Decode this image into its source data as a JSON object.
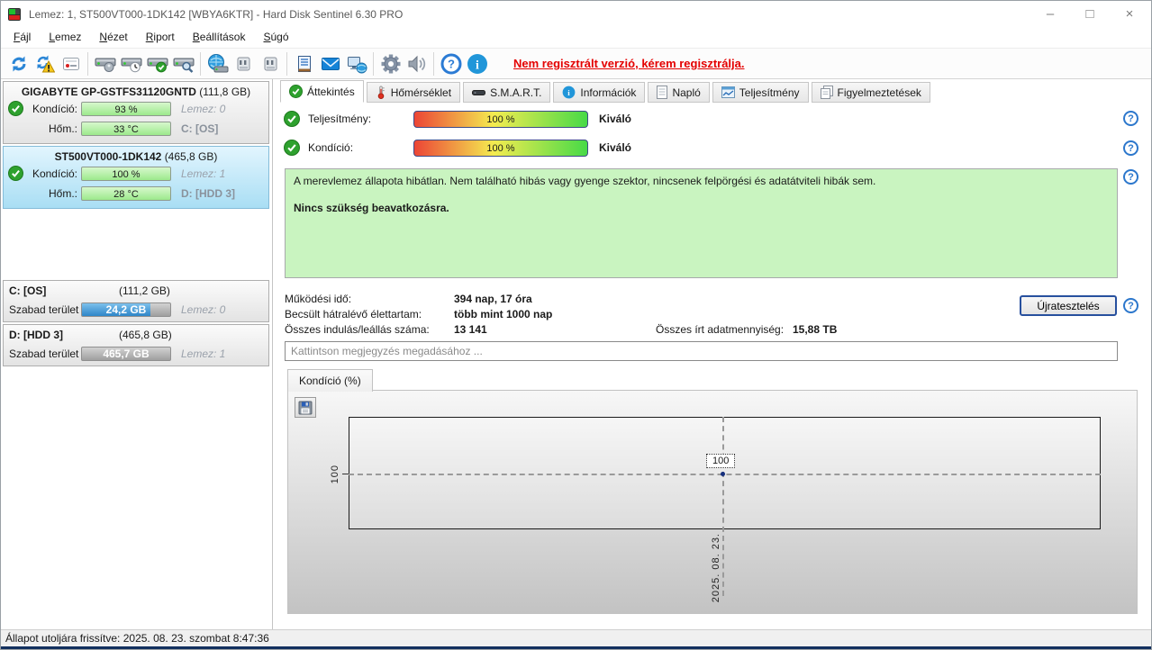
{
  "window": {
    "title": "Lemez: 1, ST500VT000-1DK142 [WBYA6KTR]  -  Hard Disk Sentinel 6.30 PRO",
    "controls": {
      "minimize": "–",
      "maximize": "□",
      "close": "×"
    }
  },
  "menu": {
    "items": [
      "Fájl",
      "Lemez",
      "Nézet",
      "Riport",
      "Beállítások",
      "Súgó"
    ]
  },
  "toolbar": {
    "register_notice": "Nem regisztrált verzió, kérem regisztrálja.",
    "icons": [
      "refresh",
      "refresh-problems",
      "report",
      "disk-detect",
      "disk-schedule",
      "disk-accept",
      "disk-test",
      "network-disk",
      "disk-offline",
      "disk-online",
      "comment-notes",
      "mail",
      "remote-monitor",
      "settings",
      "sounds",
      "help",
      "info"
    ]
  },
  "icons": {
    "help_glyph": "?",
    "info_glyph": "i"
  },
  "sidebar": {
    "disks": [
      {
        "name": "GIGABYTE GP-GSTFS31120GNTD",
        "size": "(111,8 GB)",
        "condition_label": "Kondíció:",
        "condition": "93 %",
        "temp_label": "Hőm.:",
        "temp": "33 °C",
        "disk_label": "Lemez: 0",
        "drive": "C: [OS]"
      },
      {
        "name": "ST500VT000-1DK142",
        "size": "(465,8 GB)",
        "condition_label": "Kondíció:",
        "condition": "100 %",
        "temp_label": "Hőm.:",
        "temp": "28 °C",
        "disk_label": "Lemez: 1",
        "drive": "D: [HDD 3]"
      }
    ],
    "partitions": [
      {
        "drive": "C: [OS]",
        "size": "(111,2 GB)",
        "free_label": "Szabad terület",
        "free": "24,2 GB",
        "disk_label": "Lemez: 0",
        "used_pct": 78
      },
      {
        "drive": "D: [HDD 3]",
        "size": "(465,8 GB)",
        "free_label": "Szabad terület",
        "free": "465,7 GB",
        "disk_label": "Lemez: 1",
        "used_pct": 0
      }
    ]
  },
  "tabs": [
    {
      "label": "Áttekintés"
    },
    {
      "label": "Hőmérséklet"
    },
    {
      "label": "S.M.A.R.T."
    },
    {
      "label": "Információk"
    },
    {
      "label": "Napló"
    },
    {
      "label": "Teljesítmény"
    },
    {
      "label": "Figyelmeztetések"
    }
  ],
  "overview": {
    "performance_label": "Teljesítmény:",
    "performance_value": "100 %",
    "performance_rating": "Kiváló",
    "condition_label": "Kondíció:",
    "condition_value": "100 %",
    "condition_rating": "Kiváló",
    "status_text": "A merevlemez állapota hibátlan. Nem található hibás vagy gyenge szektor, nincsenek felpörgési és adatátviteli hibák sem.",
    "status_action": "Nincs szükség beavatkozásra.",
    "stats": {
      "rows": [
        {
          "label": "Működési idő:",
          "value": "394 nap, 17 óra"
        },
        {
          "label": "Becsült hátralévő élettartam:",
          "value": "több mint 1000 nap"
        },
        {
          "label": "Összes indulás/leállás száma:",
          "value": "13 141"
        }
      ],
      "extra": {
        "label": "Összes írt adatmennyiség:",
        "value": "15,88 TB"
      }
    },
    "retest_button": "Újratesztelés",
    "comment_placeholder": "Kattintson megjegyzés megadásához ..."
  },
  "chart": {
    "tab_label": "Kondíció  (%)"
  },
  "chart_data": {
    "type": "line",
    "title": "Kondíció (%)",
    "x": [
      "2025. 08. 23."
    ],
    "values": [
      100
    ],
    "series": [
      {
        "name": "Kondíció",
        "values": [
          100
        ]
      }
    ],
    "ylabel": "Kondíció (%)",
    "ytick_labels": [
      "100"
    ],
    "xtick_labels": [
      "2025. 08. 23."
    ],
    "point_label": "100",
    "grid": "dashed-crosshair",
    "legend": "none"
  },
  "statusbar": {
    "text": "Állapot utoljára frissítve: 2025. 08. 23. szombat 8:47:36"
  }
}
